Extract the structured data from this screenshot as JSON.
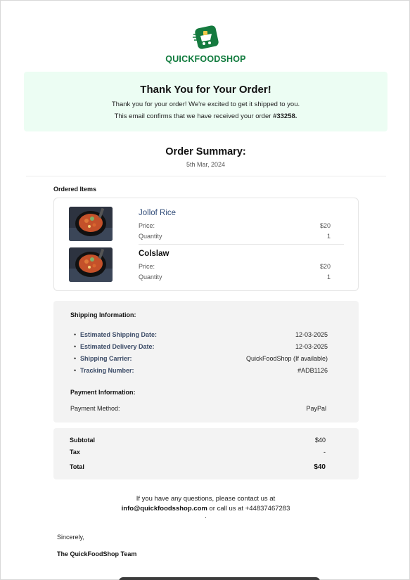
{
  "brand": {
    "name": "QUICKFOODSHOP",
    "logo_icon": "food-cart-icon",
    "brand_color": "#0f7a3c"
  },
  "banner": {
    "title": "Thank You for Your Order!",
    "line1": "Thank you for your order! We're excited to get it shipped to you.",
    "line2_prefix": "This email confirms that we have received your order",
    "order_number": "#33258.",
    "background": "#ecfdf3"
  },
  "summary": {
    "title": "Order Summary:",
    "date": "5th Mar, 2024"
  },
  "ordered_items": {
    "heading": "Ordered Items",
    "items": [
      {
        "name": "Jollof Rice",
        "price_label": "Price:",
        "price": "$20",
        "quantity_label": "Quantity",
        "quantity": "1",
        "image_icon": "jollof-rice-bowl-image"
      },
      {
        "name": "Colslaw",
        "price_label": "Price:",
        "price": "$20",
        "quantity_label": "Quantity",
        "quantity": "1",
        "image_icon": "colslaw-bowl-image"
      }
    ]
  },
  "shipping": {
    "title": "Shipping Information:",
    "rows": [
      {
        "label": "Estimated Shipping Date:",
        "value": "12-03-2025"
      },
      {
        "label": "Estimated Delivery Date:",
        "value": "12-03-2025"
      },
      {
        "label": "Shipping Carrier:",
        "value": "QuickFoodShop (If available)"
      },
      {
        "label": "Tracking Number:",
        "value": "#ADB1126"
      }
    ]
  },
  "payment": {
    "title": "Payment Information:",
    "method_label": "Payment Method:",
    "method_value": "PayPal"
  },
  "totals": {
    "subtotal_label": "Subtotal",
    "subtotal_value": "$40",
    "tax_label": "Tax",
    "tax_value": "-",
    "total_label": "Total",
    "total_value": "$40"
  },
  "contact": {
    "line1": "If you have any questions, please contact us at",
    "email": "info@quickfoodsshop.com",
    "phone_text": "or call us at +44837467283",
    "trailing": "."
  },
  "signoff": {
    "sincerely": "Sincerely,",
    "team": "The QuickFoodShop Team"
  }
}
